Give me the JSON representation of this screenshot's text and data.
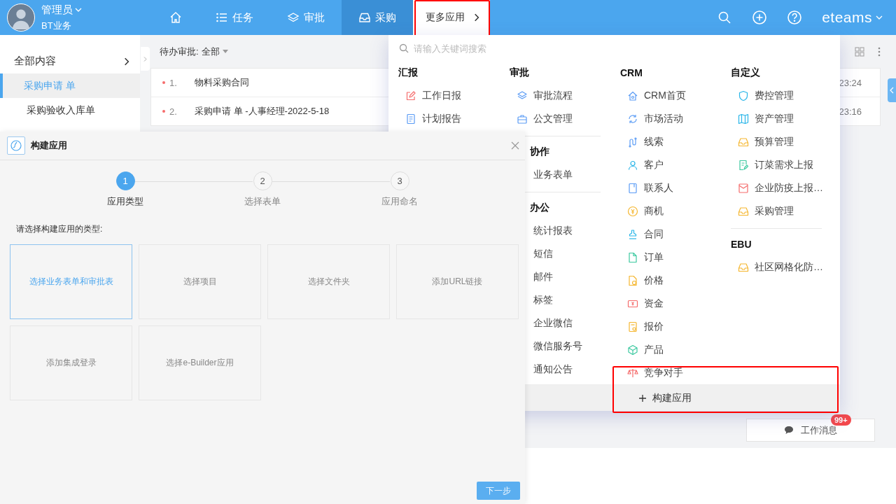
{
  "topbar": {
    "user": {
      "name": "管理员",
      "org": "BT业务"
    },
    "nav": [
      {
        "kind": "home",
        "selected": false
      },
      {
        "kind": "list",
        "label": "任务",
        "selected": false
      },
      {
        "kind": "layers",
        "label": "审批",
        "selected": false
      },
      {
        "kind": "inbox",
        "label": "采购",
        "selected": true
      }
    ],
    "more": {
      "label": "更多应用",
      "highlighted": true
    },
    "logo": "eteams"
  },
  "sidebar": {
    "items": [
      {
        "label": "全部内容",
        "kind": "group",
        "selected": false
      },
      {
        "label": "采购申请 单",
        "kind": "leaf",
        "selected": true
      },
      {
        "label": "采购验收入库单",
        "kind": "leaf",
        "selected": false
      }
    ]
  },
  "main": {
    "filter": {
      "label": "待办审批:",
      "value": "全部"
    },
    "rows": [
      {
        "number": "1.",
        "title": "物料采购合同",
        "time": "23:24",
        "unread": true
      },
      {
        "number": "2.",
        "title": "采购申请 单 -人事经理-2022-5-18",
        "time": "23:16",
        "unread": true
      }
    ],
    "message_button": {
      "label": "工作消息",
      "badge": "99+"
    }
  },
  "panel": {
    "search": {
      "placeholder": "请输入关键词搜索"
    },
    "columns": [
      [
        {
          "title": "汇报",
          "covered": false,
          "items": [
            {
              "label": "工作日报",
              "kind": "pencil"
            },
            {
              "label": "计划报告",
              "kind": "document"
            }
          ]
        }
      ],
      [
        {
          "title": "审批",
          "covered": false,
          "items": [
            {
              "label": "审批流程",
              "kind": "layers"
            },
            {
              "label": "公文管理",
              "kind": "briefcase"
            }
          ]
        },
        {
          "title": "协作",
          "covered": true,
          "items": [
            {
              "label": "业务表单"
            }
          ]
        },
        {
          "title": "办公",
          "covered": true,
          "items": [
            {
              "label": "统计报表"
            },
            {
              "label": "短信"
            },
            {
              "label": "邮件"
            },
            {
              "label": "标签"
            },
            {
              "label": "企业微信"
            },
            {
              "label": "微信服务号"
            },
            {
              "label": "通知公告"
            }
          ]
        }
      ],
      [
        {
          "title": "CRM",
          "covered": false,
          "items": [
            {
              "label": "CRM首页",
              "kind": "house"
            },
            {
              "label": "市场活动",
              "kind": "refresh"
            },
            {
              "label": "线索",
              "kind": "route"
            },
            {
              "label": "客户",
              "kind": "person"
            },
            {
              "label": "联系人",
              "kind": "contact"
            },
            {
              "label": "商机",
              "kind": "coin"
            },
            {
              "label": "合同",
              "kind": "stamp"
            },
            {
              "label": "订单",
              "kind": "file"
            },
            {
              "label": "价格",
              "kind": "pricefile"
            },
            {
              "label": "资金",
              "kind": "money"
            },
            {
              "label": "报价",
              "kind": "quote"
            },
            {
              "label": "产品",
              "kind": "cube"
            },
            {
              "label": "竞争对手",
              "kind": "scale"
            }
          ]
        }
      ],
      [
        {
          "title": "自定义",
          "covered": false,
          "items": [
            {
              "label": "费控管理",
              "kind": "shield"
            },
            {
              "label": "资产管理",
              "kind": "book"
            },
            {
              "label": "预算管理",
              "kind": "inbox"
            },
            {
              "label": "订菜需求上报",
              "kind": "notepen"
            },
            {
              "label": "企业防疫上报…",
              "kind": "envelope"
            },
            {
              "label": "采购管理",
              "kind": "inbox"
            }
          ]
        },
        {
          "title": "EBU",
          "covered": false,
          "items": [
            {
              "label": "社区网格化防…",
              "kind": "inbox"
            }
          ]
        }
      ]
    ],
    "build_button": {
      "label": "构建应用",
      "highlighted": true
    }
  },
  "dialog": {
    "title": "构建应用",
    "steps": [
      {
        "number": "1",
        "label": "应用类型",
        "selected": true
      },
      {
        "number": "2",
        "label": "选择表单",
        "selected": false
      },
      {
        "number": "3",
        "label": "应用命名",
        "selected": false
      }
    ],
    "prompt": "请选择构建应用的类型:",
    "options": [
      {
        "label": "选择业务表单和审批表",
        "selected": true
      },
      {
        "label": "选择项目",
        "selected": false
      },
      {
        "label": "选择文件夹",
        "selected": false
      },
      {
        "label": "添加URL链接",
        "selected": false
      },
      {
        "label": "添加集成登录",
        "selected": false
      },
      {
        "label": "选择e-Builder应用",
        "selected": false
      }
    ],
    "next_button": "下一步"
  }
}
